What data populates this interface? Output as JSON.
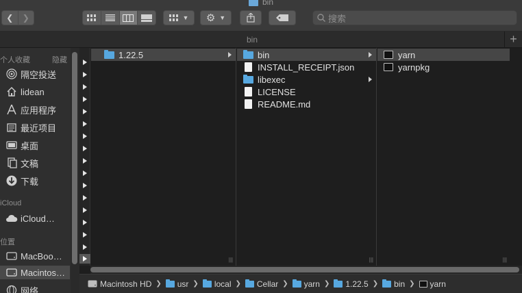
{
  "window": {
    "title": "bin"
  },
  "toolbar": {
    "back_icon": "chevron-left-icon",
    "forward_icon": "chevron-right-icon",
    "view_modes": [
      "icon-view",
      "list-view",
      "column-view",
      "gallery-view"
    ],
    "active_view": "column-view",
    "search_placeholder": "搜索"
  },
  "tabbar": {
    "tab_title": "bin",
    "add_label": "+"
  },
  "sidebar": {
    "favorites_header": "个人收藏",
    "hide_label": "隐藏",
    "favorites": [
      {
        "label": "隔空投送",
        "icon": "airdrop-icon"
      },
      {
        "label": "lidean",
        "icon": "home-icon"
      },
      {
        "label": "应用程序",
        "icon": "applications-icon"
      },
      {
        "label": "最近项目",
        "icon": "recents-icon"
      },
      {
        "label": "桌面",
        "icon": "desktop-icon"
      },
      {
        "label": "文稿",
        "icon": "documents-icon"
      },
      {
        "label": "下载",
        "icon": "downloads-icon"
      }
    ],
    "icloud_header": "iCloud",
    "icloud": [
      {
        "label": "iCloud…",
        "icon": "cloud-icon"
      }
    ],
    "locations_header": "位置",
    "locations": [
      {
        "label": "MacBoo…",
        "icon": "disk-icon"
      },
      {
        "label": "Macintos…",
        "icon": "disk-icon",
        "selected": true
      },
      {
        "label": "网络",
        "icon": "network-icon"
      }
    ]
  },
  "columns": [
    {
      "items": [
        {
          "name": "1.22.5",
          "type": "folder",
          "selected": true,
          "has_children": true
        }
      ]
    },
    {
      "items": [
        {
          "name": "bin",
          "type": "folder",
          "selected": true,
          "has_children": true
        },
        {
          "name": "INSTALL_RECEIPT.json",
          "type": "doc",
          "has_children": false
        },
        {
          "name": "libexec",
          "type": "folder",
          "has_children": true
        },
        {
          "name": "LICENSE",
          "type": "doc",
          "has_children": false
        },
        {
          "name": "README.md",
          "type": "doc",
          "has_children": false
        }
      ]
    },
    {
      "items": [
        {
          "name": "yarn",
          "type": "exec",
          "selected": true
        },
        {
          "name": "yarnpkg",
          "type": "exec"
        }
      ]
    }
  ],
  "pathbar": [
    {
      "label": "Macintosh HD",
      "icon": "disk-icon"
    },
    {
      "label": "usr",
      "icon": "folder-icon"
    },
    {
      "label": "local",
      "icon": "folder-icon"
    },
    {
      "label": "Cellar",
      "icon": "folder-icon"
    },
    {
      "label": "yarn",
      "icon": "folder-icon"
    },
    {
      "label": "1.22.5",
      "icon": "folder-icon"
    },
    {
      "label": "bin",
      "icon": "folder-icon"
    },
    {
      "label": "yarn",
      "icon": "terminal-icon"
    }
  ],
  "colors": {
    "folder": "#57a8e0",
    "selection": "#464646",
    "background": "#1e1e1e"
  }
}
